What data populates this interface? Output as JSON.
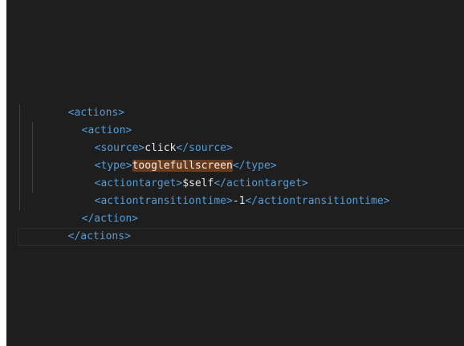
{
  "editor": {
    "lines": [
      {
        "open": "<actions>"
      },
      {
        "open": "<action>"
      },
      {
        "open": "<source>",
        "value": "click",
        "close": "</source>"
      },
      {
        "open": "<type>",
        "value": "tooglefullscreen",
        "close": "</type>"
      },
      {
        "open": "<actiontarget>",
        "value": "$self",
        "close": "</actiontarget>"
      },
      {
        "open": "<actiontransitiontime>",
        "value": "-1",
        "close": "</actiontransitiontime>"
      },
      {
        "open": "</action>"
      },
      {
        "open": "</actions>"
      }
    ],
    "colors": {
      "background": "#1e1e1e",
      "tag": "#569cd6",
      "text": "#e6e6e6",
      "find_highlight": "#6b3a1a"
    }
  }
}
